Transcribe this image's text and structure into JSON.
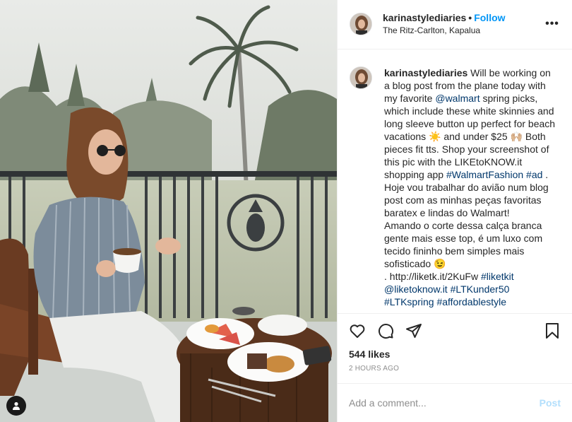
{
  "header": {
    "username": "karinastylediaries",
    "separator": "•",
    "follow_label": "Follow",
    "location": "The Ritz-Carlton, Kapalua",
    "more_label": "•••"
  },
  "caption": {
    "username": "karinastylediaries",
    "text_1": " Will be working on a blog post from the plane today with my favorite ",
    "mention_walmart": "@walmart",
    "text_2": " spring picks, which include these white skinnies and long sleeve button up perfect for beach vacations ☀️ and under $25 🙌🏼 Both pieces fit tts. Shop your screenshot of this pic with the LIKEtoKNOW.it shopping app ",
    "hashtag_fashion": "#WalmartFashion",
    "hashtag_ad": "#ad",
    "text_3": " .\nHoje vou trabalhar do avião num blog post com as minhas peças favoritas baratex e lindas do Walmart!\nAmando o corte dessa calça branca gente mais esse top, é um luxo com tecido fininho bem simples mais sofisticado 😉\n. http://liketk.it/2KuFw ",
    "hashtag_liketkit": "#liketkit",
    "mention_liketoknow": "@liketoknow.it",
    "hashtag_ltkunder50": "#LTKunder50",
    "hashtag_ltkspring": "#LTKspring",
    "hashtag_affordable": "#affordablestyle"
  },
  "likes": "544 likes",
  "time": "2 HOURS AGO",
  "comment": {
    "placeholder": "Add a comment...",
    "post_label": "Post"
  },
  "colors": {
    "link_blue": "#0095f6",
    "hashtag_blue": "#00376b",
    "post_disabled": "#b2dffc",
    "muted": "#8e8e8e",
    "divider": "#efefef"
  },
  "icons": {
    "like": "heart-icon",
    "comment": "comment-bubble-icon",
    "share": "paper-plane-icon",
    "save": "bookmark-icon",
    "more": "more-options-icon",
    "user_tag": "user-tag-icon"
  }
}
